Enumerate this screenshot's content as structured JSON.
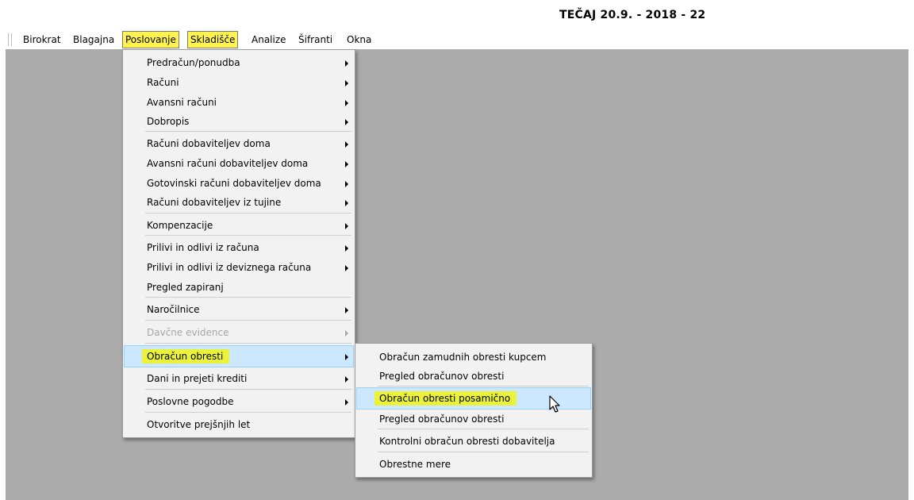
{
  "window": {
    "title": "TEČAJ 20.9. - 2018 - 22"
  },
  "menubar": {
    "items": [
      {
        "label": "Birokrat"
      },
      {
        "label": "Blagajna"
      },
      {
        "label": "Poslovanje"
      },
      {
        "label": "Skladišče"
      },
      {
        "label": "Analize"
      },
      {
        "label": "Šifranti"
      },
      {
        "label": "Okna"
      }
    ]
  },
  "poslovanje_menu": {
    "items": [
      {
        "label": "Predračun/ponudba",
        "submenu": true,
        "enabled": true
      },
      {
        "label": "Računi",
        "submenu": true,
        "enabled": true
      },
      {
        "label": "Avansni računi",
        "submenu": true,
        "enabled": true
      },
      {
        "label": "Dobropis",
        "submenu": true,
        "enabled": true
      },
      {
        "label": "Računi dobaviteljev doma",
        "submenu": true,
        "enabled": true
      },
      {
        "label": "Avansni računi dobaviteljev doma",
        "submenu": true,
        "enabled": true
      },
      {
        "label": "Gotovinski računi dobaviteljev doma",
        "submenu": true,
        "enabled": true
      },
      {
        "label": "Računi dobaviteljev iz tujine",
        "submenu": true,
        "enabled": true
      },
      {
        "label": "Kompenzacije",
        "submenu": true,
        "enabled": true
      },
      {
        "label": "Prilivi in odlivi iz računa",
        "submenu": true,
        "enabled": true
      },
      {
        "label": "Prilivi in odlivi iz deviznega računa",
        "submenu": true,
        "enabled": true
      },
      {
        "label": "Pregled zapiranj",
        "submenu": false,
        "enabled": true
      },
      {
        "label": "Naročilnice",
        "submenu": true,
        "enabled": true
      },
      {
        "label": "Davčne evidence",
        "submenu": true,
        "enabled": false
      },
      {
        "label": "Obračun obresti",
        "submenu": true,
        "enabled": true,
        "active": true
      },
      {
        "label": "Dani in prejeti krediti",
        "submenu": true,
        "enabled": true
      },
      {
        "label": "Poslovne pogodbe",
        "submenu": true,
        "enabled": true
      },
      {
        "label": "Otvoritve prejšnjih let",
        "submenu": false,
        "enabled": true
      }
    ]
  },
  "obresti_submenu": {
    "items": [
      {
        "label": "Obračun zamudnih obresti kupcem"
      },
      {
        "label": "Pregled obračunov obresti"
      },
      {
        "label": "Obračun obresti posamično",
        "active": true
      },
      {
        "label": "Pregled obračunov obresti"
      },
      {
        "label": "Kontrolni obračun obresti dobavitelja"
      },
      {
        "label": "Obrestne mere"
      }
    ]
  },
  "colors": {
    "highlight": "#fff44f",
    "selection": "#cce8ff",
    "workspace": "#ababab"
  },
  "icons": {
    "cursor": "mouse-pointer-icon",
    "submenu": "chevron-right-icon"
  }
}
